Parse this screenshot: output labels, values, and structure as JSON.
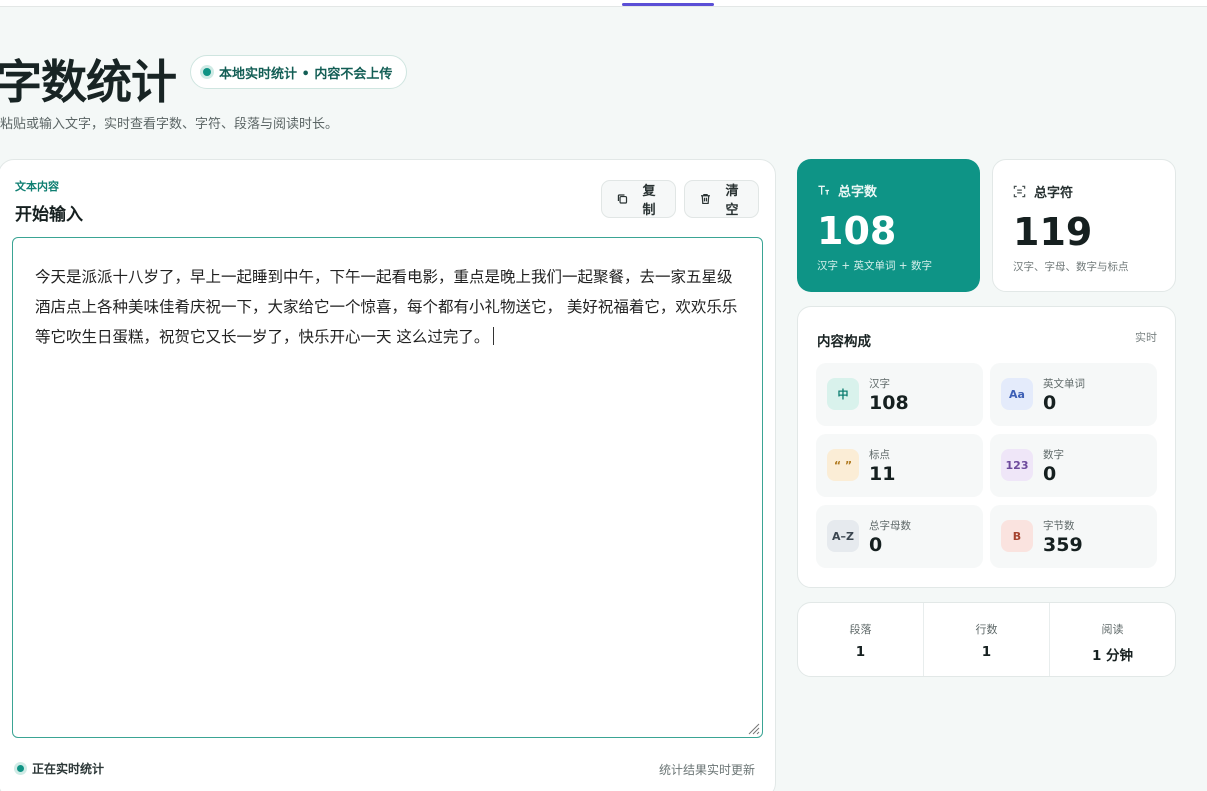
{
  "header": {
    "title": "字数统计",
    "badge": "本地实时统计 • 内容不会上传",
    "subtitle": "粘贴或输入文字，实时查看字数、字符、段落与阅读时长。"
  },
  "editor": {
    "eyebrow": "文本内容",
    "heading": "开始输入",
    "copy_label": "复制",
    "clear_label": "清空",
    "text": "今天是派派十八岁了，早上一起睡到中午，下午一起看电影，重点是晚上我们一起聚餐，去一家五星级酒店点上各种美味佳肴庆祝一下，大家给它一个惊喜，每个都有小礼物送它， 美好祝福着它，欢欢乐乐等它吹生日蛋糕，祝贺它又长一岁了，快乐开心一天 这么过完了。",
    "status": "正在实时统计",
    "status_note": "统计结果实时更新"
  },
  "stats": {
    "total_words": {
      "label": "总字数",
      "value": "108",
      "sub": "汉字 + 英文单词 + 数字"
    },
    "total_chars": {
      "label": "总字符",
      "value": "119",
      "sub": "汉字、字母、数字与标点"
    }
  },
  "composition": {
    "title": "内容构成",
    "tag": "实时",
    "items": [
      {
        "icon": "中",
        "label": "汉字",
        "value": "108"
      },
      {
        "icon": "Aa",
        "label": "英文单词",
        "value": "0"
      },
      {
        "icon": "“ ”",
        "label": "标点",
        "value": "11"
      },
      {
        "icon": "123",
        "label": "数字",
        "value": "0"
      },
      {
        "icon": "A–Z",
        "label": "总字母数",
        "value": "0"
      },
      {
        "icon": "B",
        "label": "字节数",
        "value": "359"
      }
    ]
  },
  "meta": [
    {
      "label": "段落",
      "value": "1"
    },
    {
      "label": "行数",
      "value": "1"
    },
    {
      "label": "阅读",
      "value": "1 分钟"
    }
  ],
  "colors": {
    "accent": "#0e9486",
    "nav_indicator": "#5b4fd6"
  }
}
